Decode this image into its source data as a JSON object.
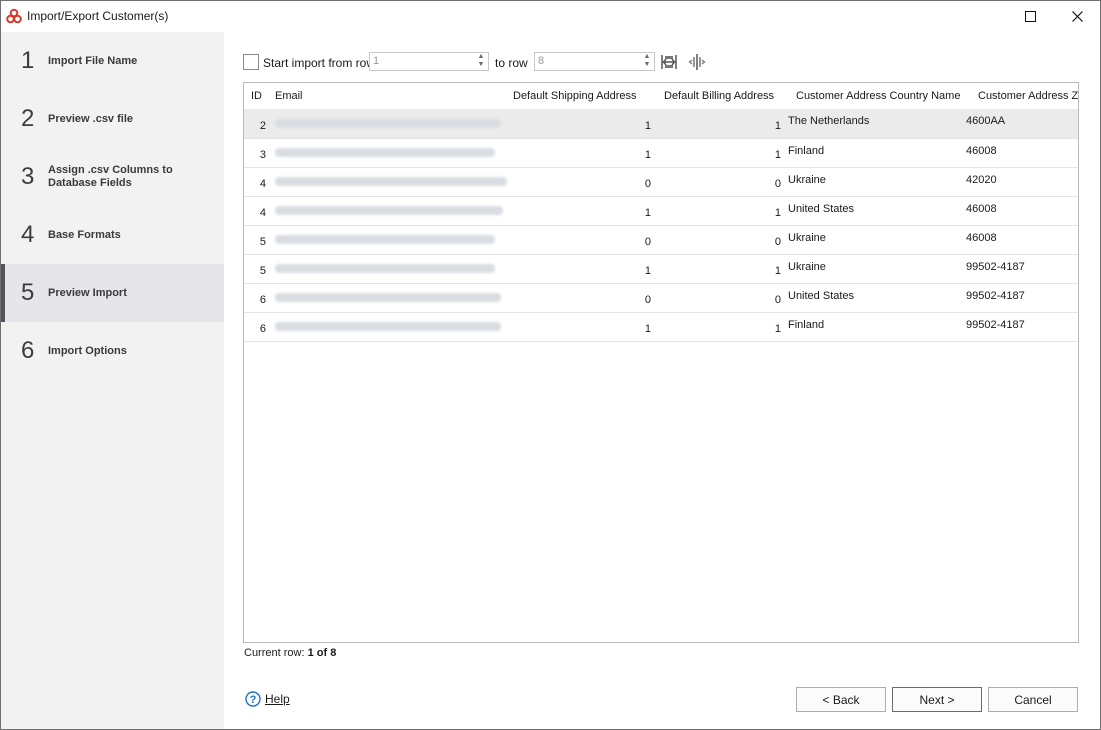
{
  "window": {
    "title": "Import/Export Customer(s)"
  },
  "sidebar": {
    "steps": [
      {
        "num": "1",
        "label": "Import File Name"
      },
      {
        "num": "2",
        "label": "Preview .csv file"
      },
      {
        "num": "3",
        "label": "Assign .csv Columns to Database Fields"
      },
      {
        "num": "4",
        "label": "Base Formats"
      },
      {
        "num": "5",
        "label": "Preview Import"
      },
      {
        "num": "6",
        "label": "Import Options"
      }
    ],
    "active_step": "5"
  },
  "toolbar": {
    "start_label": "Start import from row",
    "start_value": "1",
    "to_label": "to row",
    "to_value": "8"
  },
  "grid": {
    "columns": [
      "ID",
      "Email",
      "Default Shipping Address",
      "Default Billing Address",
      "Customer Address Country Name",
      "Customer Address Zip"
    ],
    "rows": [
      {
        "id": "2",
        "shipping": "1",
        "billing": "1",
        "country": "The Netherlands",
        "zip": "4600AA"
      },
      {
        "id": "3",
        "shipping": "1",
        "billing": "1",
        "country": "Finland",
        "zip": "46008"
      },
      {
        "id": "4",
        "shipping": "0",
        "billing": "0",
        "country": "Ukraine",
        "zip": "42020"
      },
      {
        "id": "4",
        "shipping": "1",
        "billing": "1",
        "country": "United States",
        "zip": "46008"
      },
      {
        "id": "5",
        "shipping": "0",
        "billing": "0",
        "country": "Ukraine",
        "zip": "46008"
      },
      {
        "id": "5",
        "shipping": "1",
        "billing": "1",
        "country": "Ukraine",
        "zip": "99502-4187"
      },
      {
        "id": "6",
        "shipping": "0",
        "billing": "0",
        "country": "United States",
        "zip": "99502-4187"
      },
      {
        "id": "6",
        "shipping": "1",
        "billing": "1",
        "country": "Finland",
        "zip": "99502-4187"
      }
    ]
  },
  "status": {
    "current_row_label": "Current row:",
    "current_row_value": "1 of 8"
  },
  "footer": {
    "help": "Help",
    "back": "< Back",
    "next": "Next >",
    "cancel": "Cancel"
  },
  "colors": {
    "sidebar_bg": "#f2f2f2",
    "active_step_bg": "#e6e6ea",
    "selected_row_bg": "#ebebeb",
    "help_icon": "#1e72c8",
    "app_icon": "#d63a2f"
  }
}
